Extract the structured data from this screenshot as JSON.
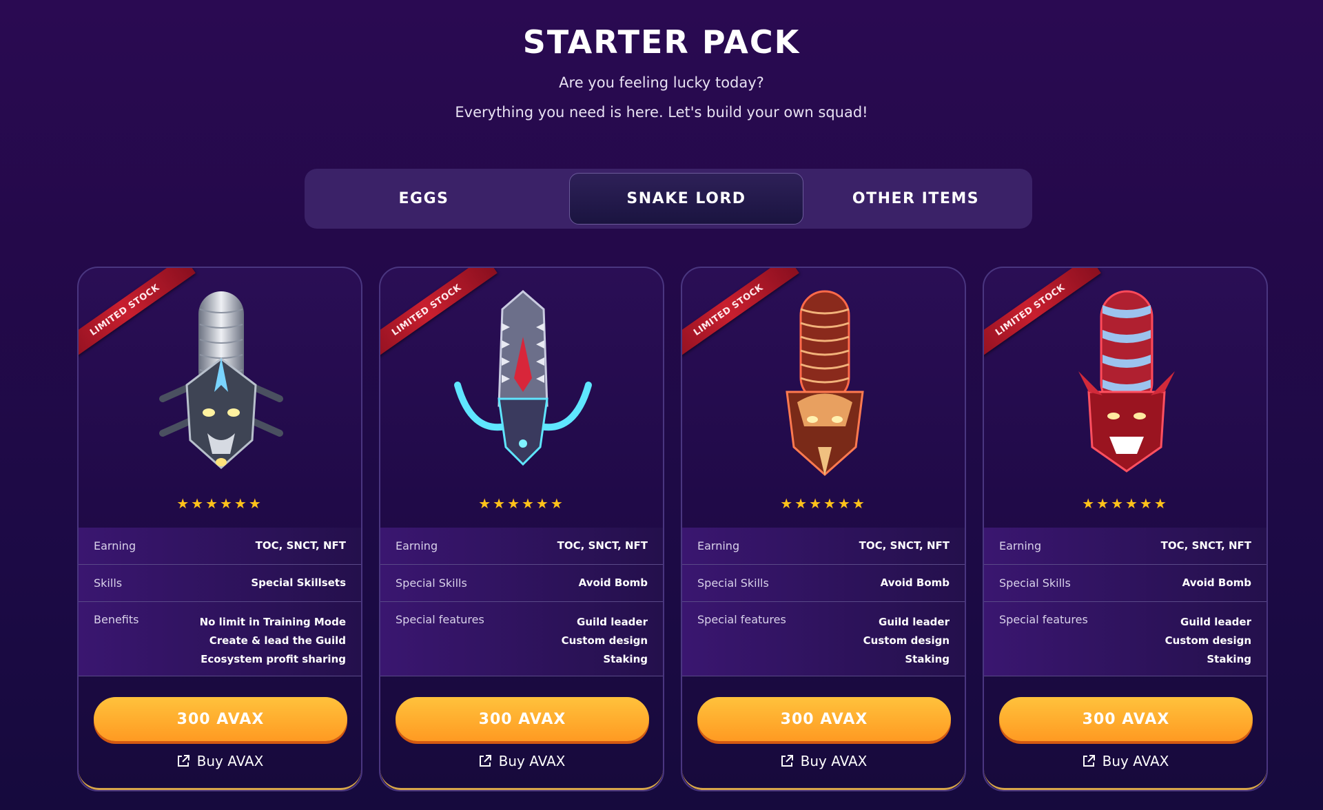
{
  "header": {
    "title": "STARTER PACK",
    "subtitle": "Are you feeling lucky today?",
    "tagline": "Everything you need is here. Let's build your own squad!"
  },
  "tabs": [
    {
      "label": "EGGS",
      "active": false
    },
    {
      "label": "SNAKE LORD",
      "active": true
    },
    {
      "label": "OTHER ITEMS",
      "active": false
    }
  ],
  "colors": {
    "accent": "#ff9a22",
    "star": "#ffc21a",
    "ribbon": "#c81f2f",
    "background": "#24094a"
  },
  "cards": [
    {
      "ribbon": "LIMITED STOCK",
      "art_icon": "silver-lion-snake-icon",
      "stars": "★★★★★★",
      "rating": 6,
      "rows": [
        {
          "label": "Earning",
          "value": [
            "TOC, SNCT, NFT"
          ]
        },
        {
          "label": "Skills",
          "value": [
            "Special Skillsets"
          ]
        },
        {
          "label": "Benefits",
          "value": [
            "No limit in Training Mode",
            "Create & lead the Guild",
            "Ecosystem profit sharing"
          ]
        }
      ],
      "price": "300 AVAX",
      "link": "Buy AVAX"
    },
    {
      "ribbon": "LIMITED STOCK",
      "art_icon": "cyan-dragon-snake-icon",
      "stars": "★★★★★★",
      "rating": 6,
      "rows": [
        {
          "label": "Earning",
          "value": [
            "TOC, SNCT, NFT"
          ]
        },
        {
          "label": "Special Skills",
          "value": [
            "Avoid Bomb"
          ]
        },
        {
          "label": "Special features",
          "value": [
            "Guild leader",
            "Custom design",
            "Staking"
          ]
        }
      ],
      "price": "300 AVAX",
      "link": "Buy AVAX"
    },
    {
      "ribbon": "LIMITED STOCK",
      "art_icon": "bronze-serpent-snake-icon",
      "stars": "★★★★★★",
      "rating": 6,
      "rows": [
        {
          "label": "Earning",
          "value": [
            "TOC, SNCT, NFT"
          ]
        },
        {
          "label": "Special Skills",
          "value": [
            "Avoid Bomb"
          ]
        },
        {
          "label": "Special features",
          "value": [
            "Guild leader",
            "Custom design",
            "Staking"
          ]
        }
      ],
      "price": "300 AVAX",
      "link": "Buy AVAX"
    },
    {
      "ribbon": "LIMITED STOCK",
      "art_icon": "red-demon-snake-icon",
      "stars": "★★★★★★",
      "rating": 6,
      "rows": [
        {
          "label": "Earning",
          "value": [
            "TOC, SNCT, NFT"
          ]
        },
        {
          "label": "Special Skills",
          "value": [
            "Avoid Bomb"
          ]
        },
        {
          "label": "Special features",
          "value": [
            "Guild leader",
            "Custom design",
            "Staking"
          ]
        }
      ],
      "price": "300 AVAX",
      "link": "Buy AVAX"
    }
  ]
}
